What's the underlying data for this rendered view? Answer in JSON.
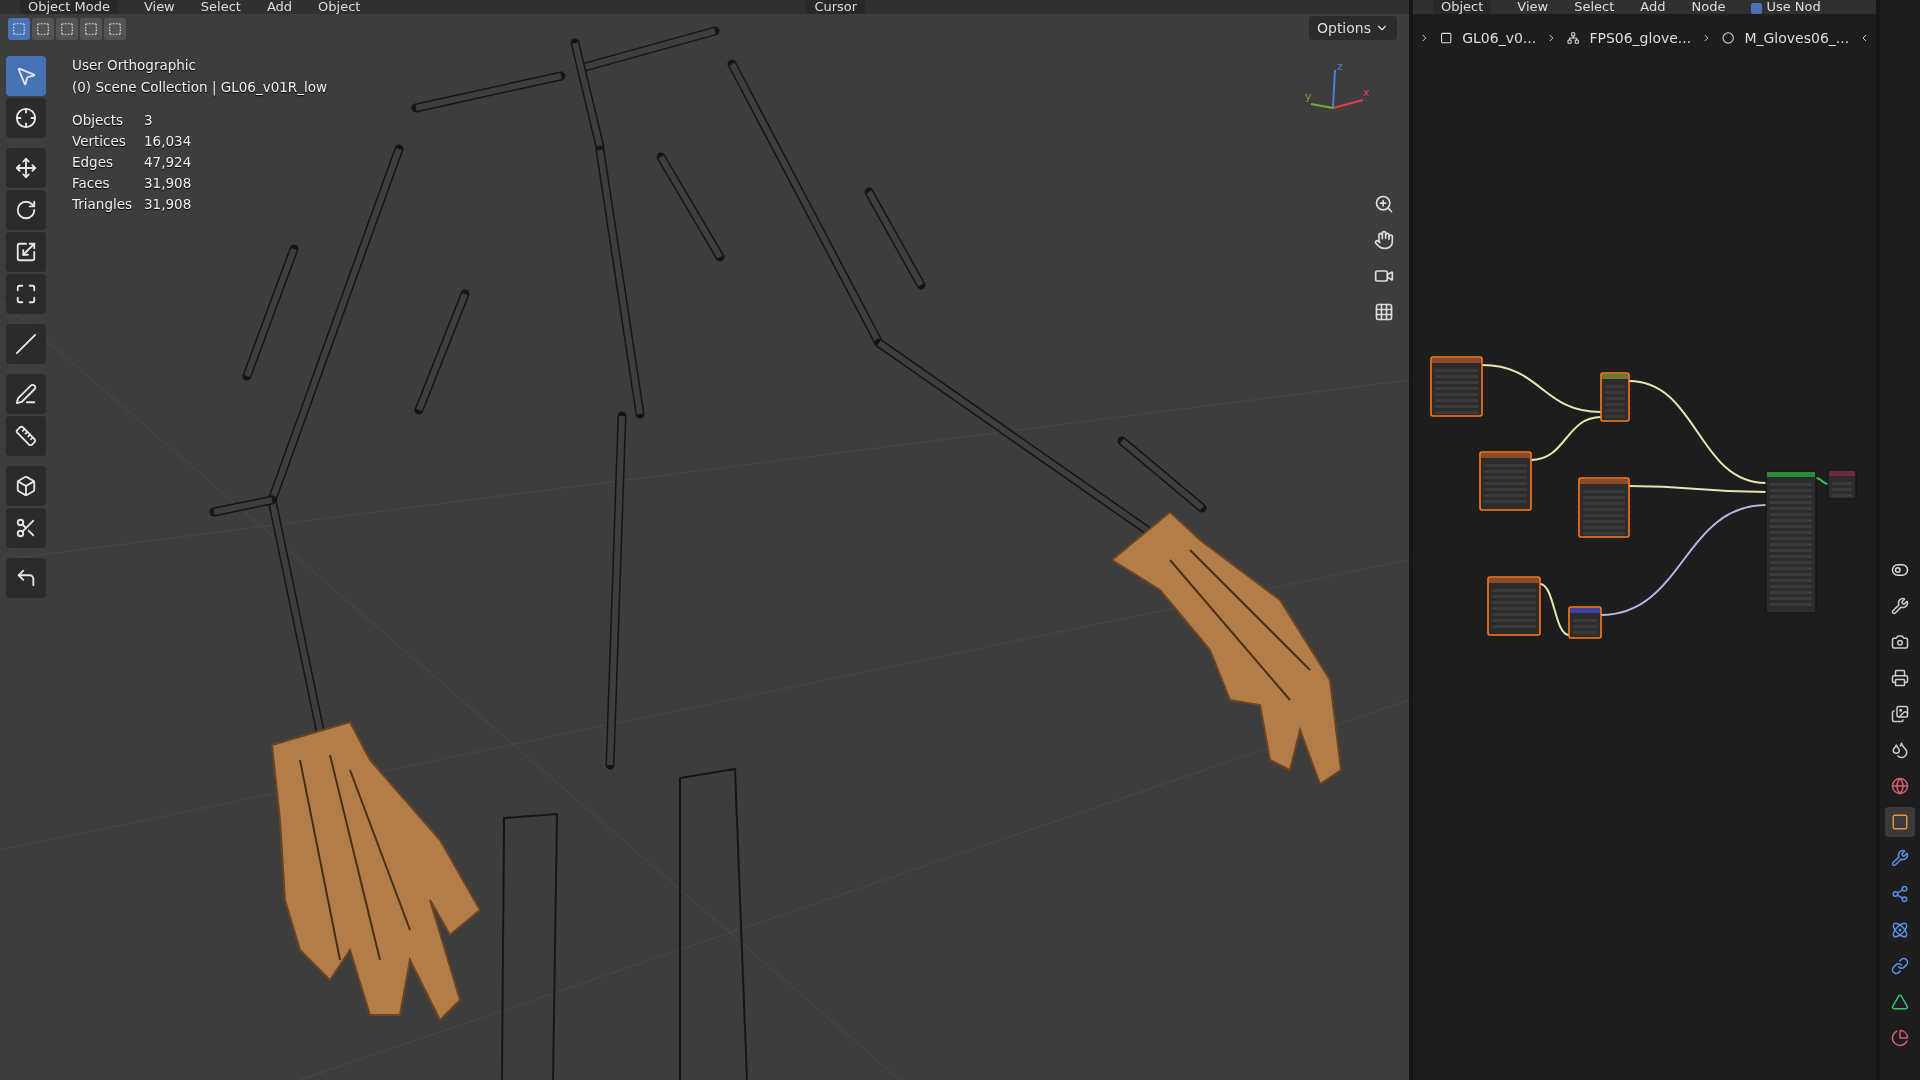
{
  "viewport_header": {
    "mode": "Object Mode",
    "menus": [
      "View",
      "Select",
      "Add",
      "Object"
    ],
    "transform": "Cursor"
  },
  "viewport": {
    "select_modes": [
      {
        "selected": true
      },
      {
        "selected": false
      },
      {
        "selected": false
      },
      {
        "selected": false
      },
      {
        "selected": false
      }
    ],
    "options": "Options",
    "view_name": "User Orthographic",
    "collection": "(0) Scene Collection | GL06_v01R_low",
    "stats": [
      {
        "label": "Objects",
        "value": "3"
      },
      {
        "label": "Vertices",
        "value": "16,034"
      },
      {
        "label": "Edges",
        "value": "47,924"
      },
      {
        "label": "Faces",
        "value": "31,908"
      },
      {
        "label": "Triangles",
        "value": "31,908"
      }
    ],
    "tools": [
      {
        "selected": true
      },
      {
        "selected": false
      },
      {
        "selected": false
      },
      {
        "selected": false
      },
      {
        "selected": false
      },
      {
        "selected": false
      },
      {
        "selected": false
      },
      {
        "selected": false
      },
      {
        "selected": false
      },
      {
        "selected": false
      },
      {
        "selected": false
      },
      {
        "selected": false
      }
    ],
    "axes": [
      "z",
      "y",
      "x"
    ]
  },
  "node_editor": {
    "mode": "Object",
    "menus": [
      "View",
      "Select",
      "Add",
      "Node"
    ],
    "use_nodes": {
      "label": "Use Nod",
      "checked": true
    },
    "breadcrumbs": [
      "GL06_v0...",
      "FPS06_glove...",
      "M_Gloves06_..."
    ],
    "nodes": [
      {
        "kind": "texture",
        "selected": true
      },
      {
        "kind": "mix",
        "selected": true
      },
      {
        "kind": "texture",
        "selected": true
      },
      {
        "kind": "texture",
        "selected": true
      },
      {
        "kind": "texture",
        "selected": true
      },
      {
        "kind": "normal",
        "selected": true
      },
      {
        "kind": "bsdf",
        "selected": false
      },
      {
        "kind": "output",
        "selected": false
      }
    ],
    "links": [
      {
        "color": "#e8e6b0"
      },
      {
        "color": "#e8e6b0"
      },
      {
        "color": "#e8e6b0"
      },
      {
        "color": "#e8e6b0"
      },
      {
        "color": "#e8e6b0"
      },
      {
        "color": "#b8b6e8"
      },
      {
        "color": "#3cc060"
      }
    ]
  },
  "properties_tabs": [
    {
      "selected": false
    },
    {
      "selected": false
    },
    {
      "selected": false
    },
    {
      "selected": false
    },
    {
      "selected": false
    },
    {
      "selected": false
    },
    {
      "selected": false
    },
    {
      "selected": true
    },
    {
      "selected": false
    },
    {
      "selected": false
    },
    {
      "selected": false
    },
    {
      "selected": false
    },
    {
      "selected": false
    },
    {
      "selected": false
    }
  ]
}
